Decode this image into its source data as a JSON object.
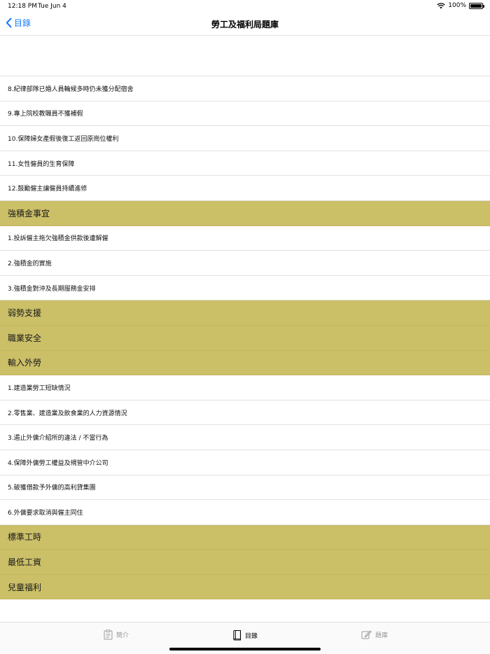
{
  "status_bar": {
    "time": "12:18 PM",
    "date": "Tue Jun 4",
    "battery": "100%"
  },
  "nav": {
    "back_label": "目錄",
    "title": "勞工及福利局題庫"
  },
  "rows": [
    {
      "type": "item",
      "label": "8.紀律部隊已婚人員輪候多時仍未獲分配宿舍"
    },
    {
      "type": "item",
      "label": "9.專上院校教職員不獲補假"
    },
    {
      "type": "item",
      "label": "10.保障婦女產假後復工返回原崗位權利"
    },
    {
      "type": "item",
      "label": "11.女性僱員的生育保障"
    },
    {
      "type": "item",
      "label": "12.鼓勵僱主讓僱員持續進修"
    },
    {
      "type": "section",
      "label": "強積金事宜"
    },
    {
      "type": "item",
      "label": "1.投訴僱主拖欠強積金供款後遭解僱"
    },
    {
      "type": "item",
      "label": "2.強積金的實施"
    },
    {
      "type": "item",
      "label": "3.強積金對沖及長期服務金安排"
    },
    {
      "type": "section",
      "label": "弱勢支援"
    },
    {
      "type": "section",
      "label": "職業安全"
    },
    {
      "type": "section",
      "label": "輸入外勞"
    },
    {
      "type": "item",
      "label": "1.建造業勞工短缺情況"
    },
    {
      "type": "item",
      "label": "2.零售業、建造業及飲食業的人力資源情況"
    },
    {
      "type": "item",
      "label": "3.遏止外傭介紹所的違法 / 不當行為"
    },
    {
      "type": "item",
      "label": "4.保障外傭勞工權益及規管中介公司"
    },
    {
      "type": "item",
      "label": "5.破獲借款予外傭的高利貸集團"
    },
    {
      "type": "item",
      "label": "6.外傭要求取消與僱主同住"
    },
    {
      "type": "section",
      "label": "標準工時"
    },
    {
      "type": "section",
      "label": "最低工資"
    },
    {
      "type": "section",
      "label": "兒童福利"
    }
  ],
  "tabs": {
    "intro": {
      "label": "簡介",
      "icon": "clipboard-icon"
    },
    "contents": {
      "label": "目錄",
      "icon": "book-icon",
      "active": true
    },
    "bank": {
      "label": "題庫",
      "icon": "edit-icon"
    }
  },
  "colors": {
    "accent": "#1a7cf5",
    "section_bg": "#cbbf68"
  }
}
